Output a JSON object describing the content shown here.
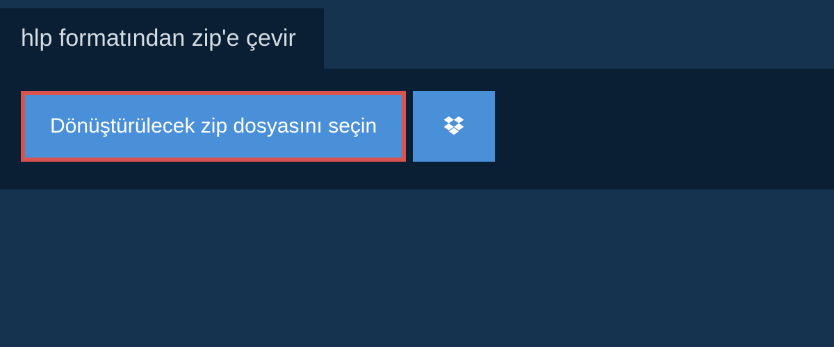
{
  "header": {
    "title": "hlp formatından zip'e çevir"
  },
  "main": {
    "select_file_label": "Dönüştürülecek zip dosyasını seçin"
  },
  "colors": {
    "background": "#15334f",
    "panel": "#0a1f33",
    "button": "#4a90d9",
    "highlight_border": "#d9534f",
    "text_light": "#d4dce4",
    "text_white": "#ffffff"
  }
}
